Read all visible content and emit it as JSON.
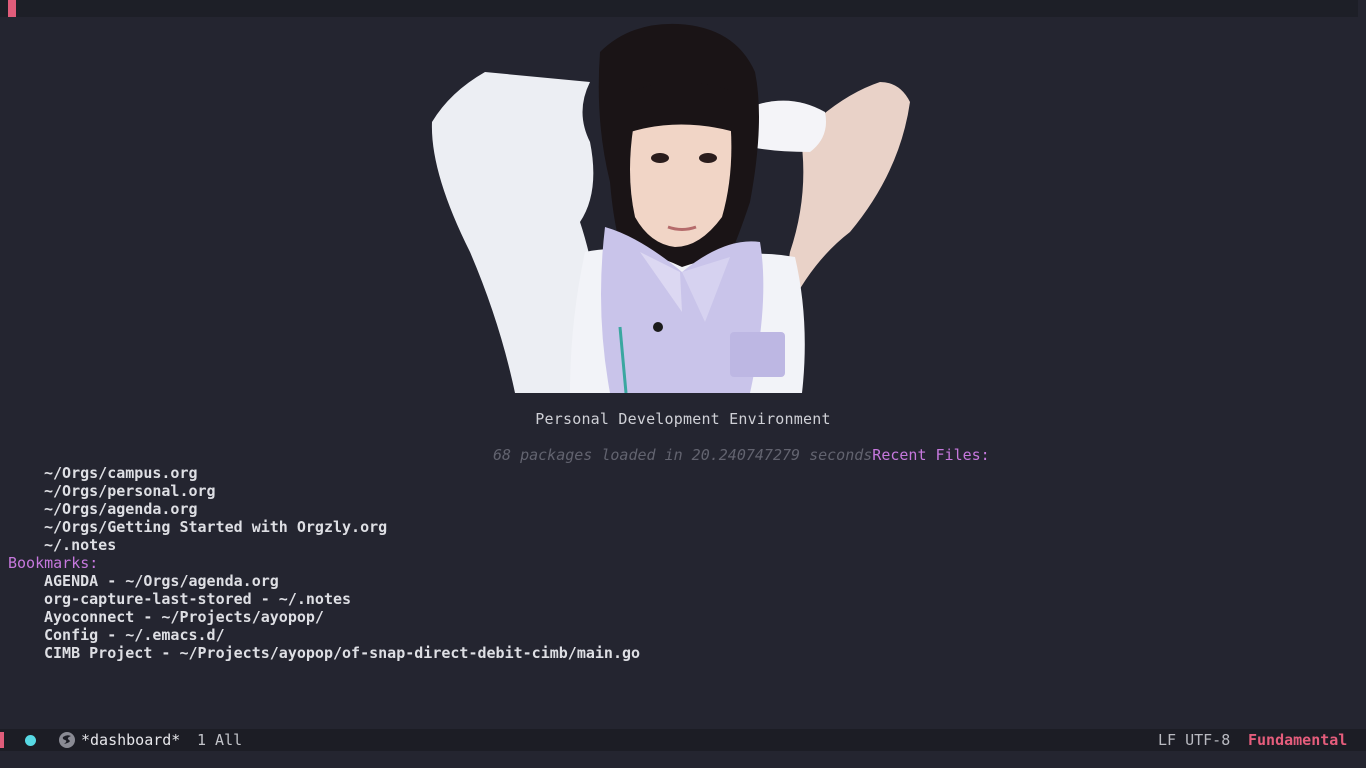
{
  "tabbar": {
    "accent_color": "#e05c7a"
  },
  "banner": {
    "image_alt": "dashboard banner image",
    "title": "Personal Development Environment",
    "load_info": "68 packages loaded in 20.240747279 seconds"
  },
  "recent_files": {
    "heading": "Recent Files:",
    "items": [
      "~/Orgs/campus.org",
      "~/Orgs/personal.org",
      "~/Orgs/agenda.org",
      "~/Orgs/Getting Started with Orgzly.org",
      "~/.notes"
    ]
  },
  "bookmarks": {
    "heading": "Bookmarks:",
    "items": [
      "AGENDA - ~/Orgs/agenda.org",
      "org-capture-last-stored - ~/.notes",
      "Ayoconnect - ~/Projects/ayopop/",
      "Config - ~/.emacs.d/",
      "CIMB Project - ~/Projects/ayopop/of-snap-direct-debit-cimb/main.go"
    ]
  },
  "modeline": {
    "buffer_name": "*dashboard*",
    "position": "1 All",
    "encoding": "LF UTF-8",
    "major_mode": "Fundamental",
    "status_color": "#57d9e4",
    "mode_color": "#e55d7c",
    "icon": "emacs-logo-icon"
  }
}
